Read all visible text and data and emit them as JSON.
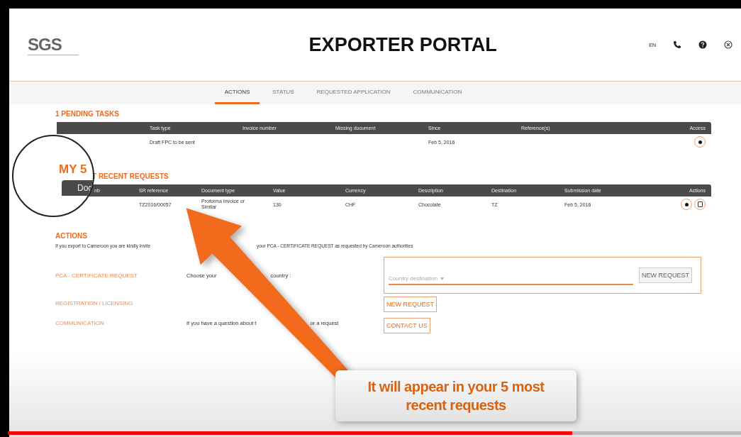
{
  "header": {
    "logo": "SGS",
    "title": "EXPORTER PORTAL",
    "language": "EN"
  },
  "tabs": [
    {
      "label": "ACTIONS",
      "selected": true
    },
    {
      "label": "STATUS",
      "selected": false
    },
    {
      "label": "REQUESTED APPLICATION",
      "selected": false
    },
    {
      "label": "COMMUNICATION",
      "selected": false
    }
  ],
  "pending_tasks": {
    "title": "1 PENDING TASKS",
    "columns": [
      "Task type",
      "Invoice number",
      "Missing document",
      "Since",
      "Reference(s)",
      "Access"
    ],
    "rows": [
      {
        "task_type": "Draft FPC to be sent",
        "since": "Feb 5, 2016"
      }
    ]
  },
  "recent_requests": {
    "title": "T RECENT REQUESTS",
    "columns": [
      "nb",
      "SR reference",
      "Document type",
      "Value",
      "Currency",
      "Description",
      "Destination",
      "Submission date",
      "Actions"
    ],
    "rows": [
      {
        "sr_reference": "TZ2016/00057",
        "document_type": "Proforma Invoice or Similar",
        "value": "130",
        "currency": "CHF",
        "description": "Chocolate",
        "destination": "TZ",
        "submission_date": "Feb 5, 2016"
      }
    ]
  },
  "magnifier": {
    "heading": "MY 5",
    "column": "Doc"
  },
  "actions": {
    "title": "ACTIONS",
    "intro_parts": [
      "If you export to Cameroon you are kindly invite",
      "your PCA - CERTIFICATE REQUEST as requested by Cameroon authorities"
    ],
    "items": [
      {
        "kind": "select",
        "label": "PCA - CERTIFICATE REQUEST",
        "text_parts": [
          "Choose your",
          "country :"
        ],
        "placeholder": "Country destination",
        "button": "NEW REQUEST"
      },
      {
        "kind": "button",
        "label": "REGISTRATION / LICENSING",
        "button": "NEW REQUEST"
      },
      {
        "kind": "button",
        "label": "COMMUNICATION",
        "text_parts": [
          "If you have a question about t",
          "or a request"
        ],
        "button": "CONTACT US"
      }
    ]
  },
  "callout": {
    "text": "It will appear in your 5 most recent requests"
  },
  "video_progress": {
    "level": 0.77
  }
}
